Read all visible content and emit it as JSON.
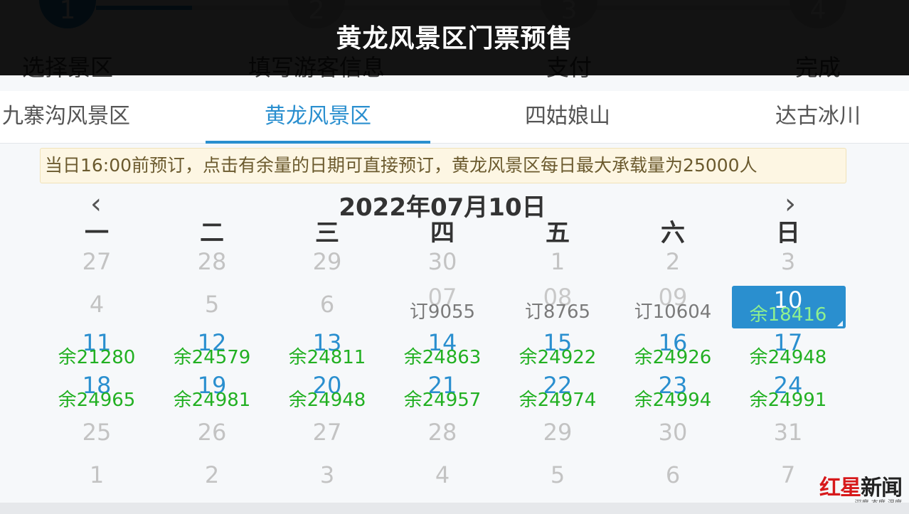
{
  "header": {
    "title": "黄龙风景区门票预售"
  },
  "steps": [
    {
      "num": "1",
      "label": "选择景区"
    },
    {
      "num": "2",
      "label": "填写游客信息"
    },
    {
      "num": "3",
      "label": "支付"
    },
    {
      "num": "4",
      "label": "完成"
    }
  ],
  "tabs": [
    {
      "label": "九寨沟风景区"
    },
    {
      "label": "黄龙风景区"
    },
    {
      "label": "四姑娘山"
    },
    {
      "label": "达古冰川"
    }
  ],
  "notice": "当日16:00前预订，点击有余量的日期可直接预订，黄龙风景区每日最大承载量为25000人",
  "calendar": {
    "title": "2022年07月10日",
    "prev": "‹",
    "next": "›",
    "weekdays": [
      "一",
      "二",
      "三",
      "四",
      "五",
      "六",
      "日"
    ],
    "rows": [
      [
        {
          "n": "27",
          "t": "other"
        },
        {
          "n": "28",
          "t": "other"
        },
        {
          "n": "29",
          "t": "other"
        },
        {
          "n": "30",
          "t": "other"
        },
        {
          "n": "1",
          "t": "past"
        },
        {
          "n": "2",
          "t": "past"
        },
        {
          "n": "3",
          "t": "past"
        }
      ],
      [
        {
          "n": "4",
          "t": "past"
        },
        {
          "n": "5",
          "t": "past"
        },
        {
          "n": "6",
          "t": "past"
        },
        {
          "n": "07",
          "t": "booked",
          "s": "订9055"
        },
        {
          "n": "08",
          "t": "booked",
          "s": "订8765"
        },
        {
          "n": "09",
          "t": "booked",
          "s": "订10604"
        },
        {
          "n": "10",
          "t": "selected",
          "s": "余18416"
        }
      ],
      [
        {
          "n": "11",
          "t": "avail",
          "s": "余21280"
        },
        {
          "n": "12",
          "t": "avail",
          "s": "余24579"
        },
        {
          "n": "13",
          "t": "avail",
          "s": "余24811"
        },
        {
          "n": "14",
          "t": "avail",
          "s": "余24863"
        },
        {
          "n": "15",
          "t": "avail",
          "s": "余24922"
        },
        {
          "n": "16",
          "t": "avail",
          "s": "余24926"
        },
        {
          "n": "17",
          "t": "avail",
          "s": "余24948"
        }
      ],
      [
        {
          "n": "18",
          "t": "avail",
          "s": "余24965"
        },
        {
          "n": "19",
          "t": "avail",
          "s": "余24981"
        },
        {
          "n": "20",
          "t": "avail",
          "s": "余24948"
        },
        {
          "n": "21",
          "t": "avail",
          "s": "余24957"
        },
        {
          "n": "22",
          "t": "avail",
          "s": "余24974"
        },
        {
          "n": "23",
          "t": "avail",
          "s": "余24994"
        },
        {
          "n": "24",
          "t": "avail",
          "s": "余24991"
        }
      ],
      [
        {
          "n": "25",
          "t": "other"
        },
        {
          "n": "26",
          "t": "other"
        },
        {
          "n": "27",
          "t": "other"
        },
        {
          "n": "28",
          "t": "other"
        },
        {
          "n": "29",
          "t": "other"
        },
        {
          "n": "30",
          "t": "other"
        },
        {
          "n": "31",
          "t": "other"
        }
      ],
      [
        {
          "n": "1",
          "t": "other"
        },
        {
          "n": "2",
          "t": "other"
        },
        {
          "n": "3",
          "t": "other"
        },
        {
          "n": "4",
          "t": "other"
        },
        {
          "n": "5",
          "t": "other"
        },
        {
          "n": "6",
          "t": "other"
        },
        {
          "n": "7",
          "t": "other"
        }
      ]
    ]
  },
  "watermark": {
    "red": "红星",
    "dark": "新闻",
    "sub": "深度 态度 温度"
  },
  "colors": {
    "accent": "#2a8fcf",
    "available": "#22b022",
    "header_bg": "#0a0a0a"
  }
}
